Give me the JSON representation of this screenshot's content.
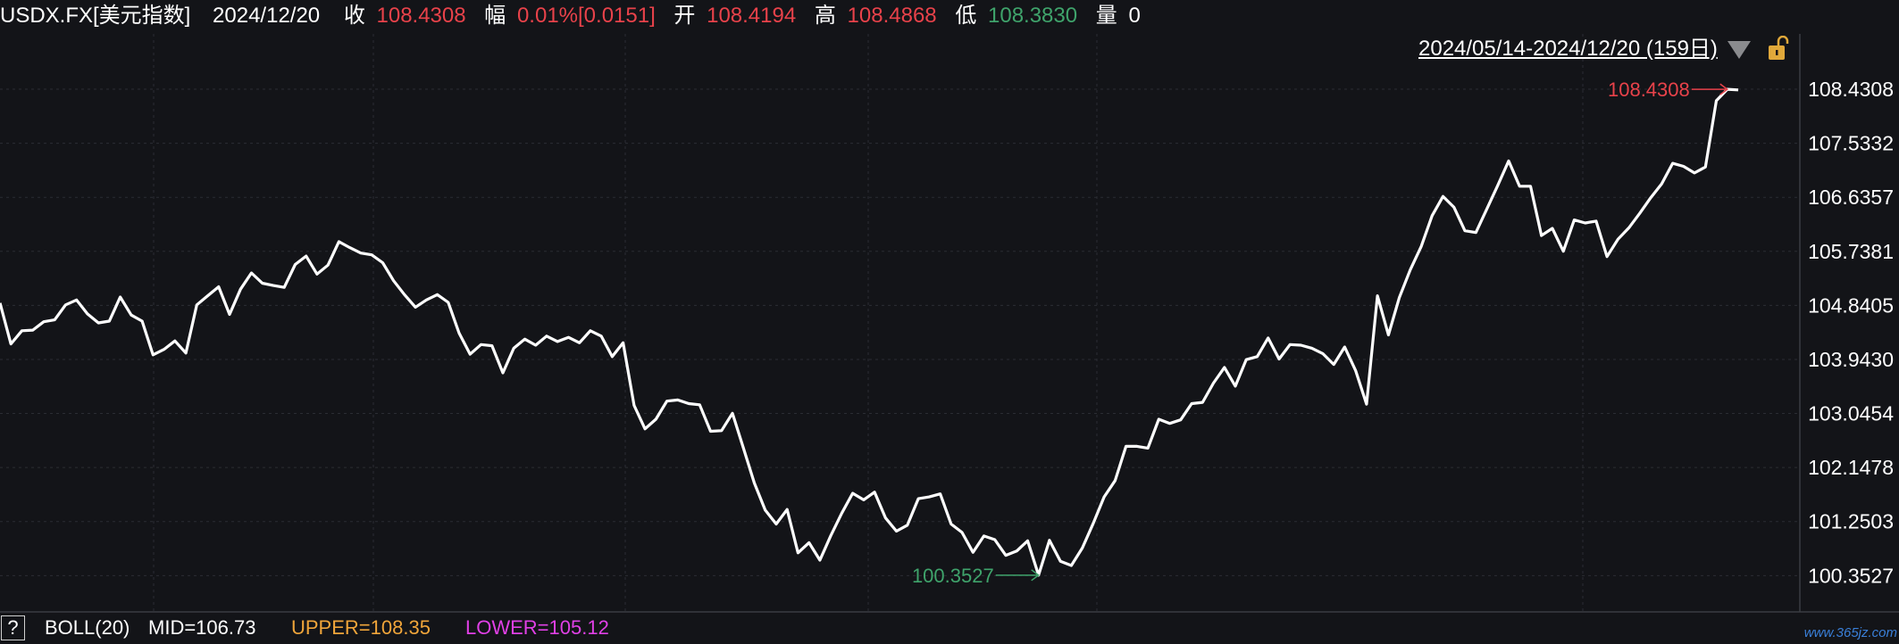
{
  "header": {
    "symbol": "USDX.FX[美元指数]",
    "date": "2024/12/20",
    "close_label": "收",
    "close_value": "108.4308",
    "range_label": "幅",
    "range_value": "0.01%[0.0151]",
    "open_label": "开",
    "open_value": "108.4194",
    "high_label": "高",
    "high_value": "108.4868",
    "low_label": "低",
    "low_value": "108.3830",
    "volume_label": "量",
    "volume_value": "0"
  },
  "date_range": "2024/05/14-2024/12/20 (159日)",
  "footer": {
    "help": "?",
    "boll": "BOLL(20)",
    "mid": "MID=106.73",
    "upper": "UPPER=108.35",
    "lower": "LOWER=105.12"
  },
  "watermark": "www.365jz.com",
  "colors": {
    "background": "#131418",
    "line": "#ffffff",
    "up": "#e8424a",
    "down": "#3fa36b",
    "upper": "#f0a53a",
    "lower": "#e040e6",
    "grid": "#2b2d33"
  },
  "icons": {
    "dropdown": "triangle-down-icon",
    "lock": "padlock-open-icon"
  },
  "chart_data": {
    "type": "line",
    "title": "",
    "xlabel": "",
    "ylabel": "",
    "x": [
      "2024/05/14",
      "2024/12/20"
    ],
    "ylim": [
      99.75,
      109.35
    ],
    "yticks": [
      "108.4308",
      "107.5332",
      "106.6357",
      "105.7381",
      "104.8405",
      "103.9430",
      "103.0454",
      "102.1478",
      "101.2503",
      "100.3527"
    ],
    "grid": true,
    "annotations": {
      "high": "108.4308",
      "low": "100.3527"
    },
    "series": [
      {
        "values": [
          104.88,
          104.2,
          104.42,
          104.43,
          104.57,
          104.6,
          104.85,
          104.93,
          104.7,
          104.55,
          104.58,
          104.98,
          104.68,
          104.58,
          104.02,
          104.11,
          104.25,
          104.05,
          104.85,
          105.0,
          105.15,
          104.69,
          105.11,
          105.38,
          105.21,
          105.17,
          105.14,
          105.52,
          105.66,
          105.36,
          105.51,
          105.9,
          105.8,
          105.71,
          105.68,
          105.55,
          105.25,
          105.02,
          104.81,
          104.93,
          105.02,
          104.89,
          104.38,
          104.03,
          104.19,
          104.17,
          103.72,
          104.13,
          104.28,
          104.18,
          104.33,
          104.24,
          104.31,
          104.22,
          104.42,
          104.33,
          103.99,
          104.22,
          103.18,
          102.79,
          102.95,
          103.25,
          103.27,
          103.21,
          103.19,
          102.75,
          102.76,
          103.05,
          102.47,
          101.89,
          101.44,
          101.21,
          101.45,
          100.73,
          100.9,
          100.61,
          101.02,
          101.39,
          101.72,
          101.61,
          101.74,
          101.31,
          101.09,
          101.19,
          101.63,
          101.66,
          101.71,
          101.21,
          101.07,
          100.74,
          101.01,
          100.95,
          100.69,
          100.76,
          100.93,
          100.36,
          100.94,
          100.59,
          100.52,
          100.81,
          101.22,
          101.66,
          101.93,
          102.5,
          102.5,
          102.47,
          102.95,
          102.88,
          102.94,
          103.21,
          103.23,
          103.55,
          103.81,
          103.5,
          103.94,
          103.99,
          104.3,
          103.95,
          104.19,
          104.18,
          104.13,
          104.04,
          103.86,
          104.15,
          103.76,
          103.2,
          105.0,
          104.35,
          104.97,
          105.43,
          105.82,
          106.33,
          106.65,
          106.47,
          106.08,
          106.05,
          106.44,
          106.83,
          107.24,
          106.82,
          106.82,
          106.0,
          106.12,
          105.74,
          106.26,
          106.21,
          106.24,
          105.65,
          105.94,
          106.13,
          106.37,
          106.63,
          106.86,
          107.2,
          107.15,
          107.04,
          107.14,
          108.24,
          108.43,
          108.42
        ]
      }
    ]
  }
}
